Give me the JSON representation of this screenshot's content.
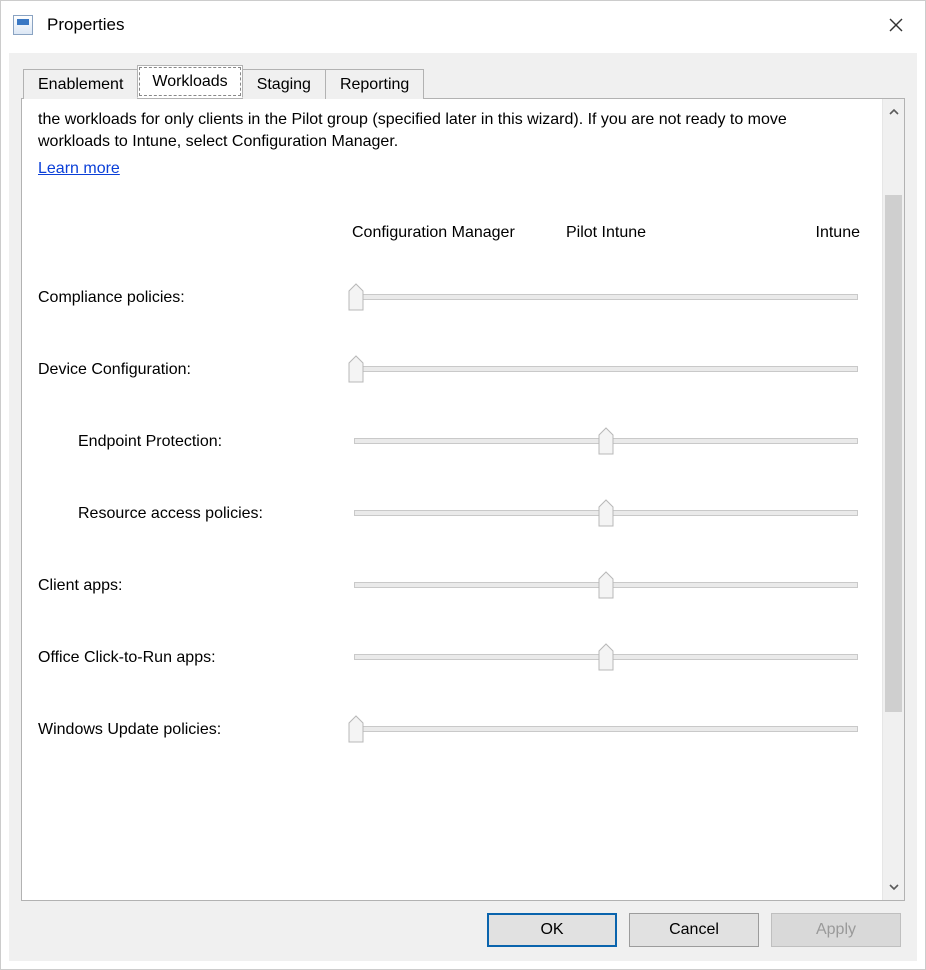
{
  "window": {
    "title": "Properties"
  },
  "tabs": [
    {
      "label": "Enablement"
    },
    {
      "label": "Workloads"
    },
    {
      "label": "Staging"
    },
    {
      "label": "Reporting"
    }
  ],
  "active_tab_index": 1,
  "workloads": {
    "description": "the workloads for only clients in the Pilot group (specified later in this wizard). If you are not ready to move workloads to Intune, select Configuration Manager.",
    "learn_more_label": "Learn more",
    "columns": {
      "left": "Configuration Manager",
      "center": "Pilot Intune",
      "right": "Intune"
    },
    "rows": [
      {
        "label": "Compliance policies:",
        "indent": false,
        "position": 0
      },
      {
        "label": "Device Configuration:",
        "indent": false,
        "position": 0
      },
      {
        "label": "Endpoint Protection:",
        "indent": true,
        "position": 1
      },
      {
        "label": "Resource access policies:",
        "indent": true,
        "position": 1
      },
      {
        "label": "Client apps:",
        "indent": false,
        "position": 1
      },
      {
        "label": "Office Click-to-Run apps:",
        "indent": false,
        "position": 1
      },
      {
        "label": "Windows Update policies:",
        "indent": false,
        "position": 0
      }
    ]
  },
  "buttons": {
    "ok": "OK",
    "cancel": "Cancel",
    "apply": "Apply"
  }
}
